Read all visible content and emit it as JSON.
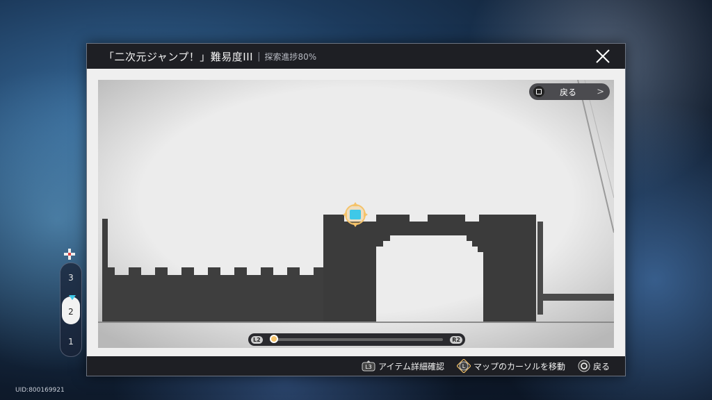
{
  "window": {
    "title": "「二次元ジャンプ！」難易度III",
    "separator": "|",
    "progress": "探索進捗80%"
  },
  "back_button": {
    "label": "戻る"
  },
  "slider": {
    "left_tag": "L2",
    "right_tag": "R2",
    "position_fraction": 0.0
  },
  "floors": [
    {
      "label": "3",
      "active": false
    },
    {
      "label": "2",
      "active": true
    },
    {
      "label": "1",
      "active": false
    }
  ],
  "footer": {
    "hint_item_key": "L3",
    "hint_item": "アイテム詳細確認",
    "hint_cursor_key": "L",
    "hint_cursor": "マップのカーソルを移動",
    "hint_back": "戻る"
  },
  "uid": "UID:800169921",
  "icons": {
    "close": "close-icon",
    "player_marker": "player-marker-icon",
    "dpad": "dpad-icon",
    "back_button_o": "square-button-icon",
    "chevron": "chevron-right-icon"
  },
  "colors": {
    "header_bg": "#1e1f24",
    "castle": "#3b3b3b",
    "marker_blue": "#3ec8e8",
    "marker_gold": "#f5c36a"
  }
}
